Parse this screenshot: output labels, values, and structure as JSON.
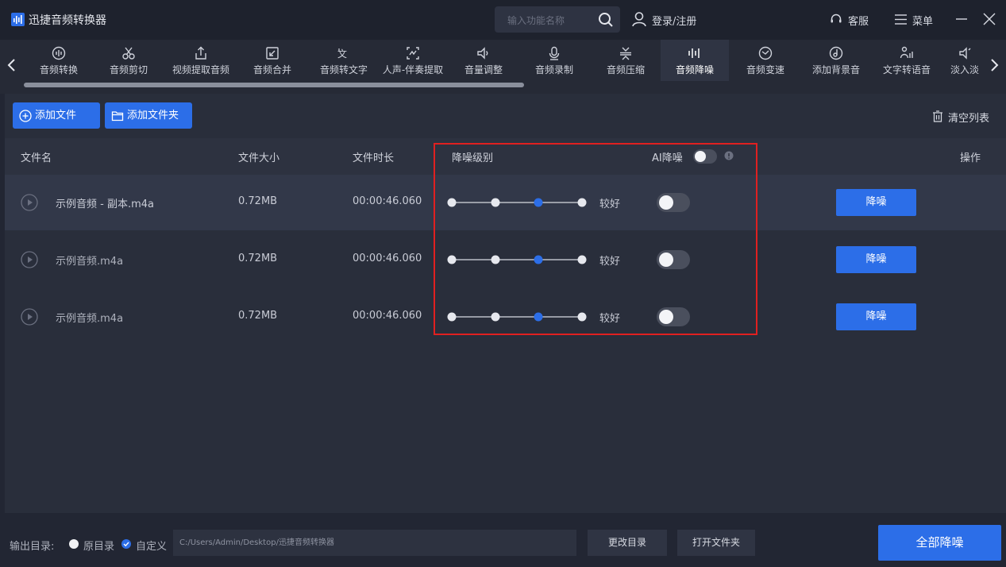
{
  "app": {
    "title": "迅捷音频转换器"
  },
  "header": {
    "search_placeholder": "输入功能名称",
    "login": "登录/注册",
    "service": "客服",
    "menu": "菜单"
  },
  "toolbar": {
    "tools": [
      {
        "label": "音频转换",
        "icon": "audio-convert-icon"
      },
      {
        "label": "音频剪切",
        "icon": "scissors-icon"
      },
      {
        "label": "视频提取音频",
        "icon": "upload-icon"
      },
      {
        "label": "音频合并",
        "icon": "merge-icon"
      },
      {
        "label": "音频转文字",
        "icon": "text-icon"
      },
      {
        "label": "人声-伴奏提取",
        "icon": "vocal-icon"
      },
      {
        "label": "音量调整",
        "icon": "volume-icon"
      },
      {
        "label": "音频录制",
        "icon": "mic-icon"
      },
      {
        "label": "音频压缩",
        "icon": "compress-icon"
      },
      {
        "label": "音频降噪",
        "icon": "denoise-icon",
        "active": true
      },
      {
        "label": "音频变速",
        "icon": "speed-icon"
      },
      {
        "label": "添加背景音",
        "icon": "music-note-icon"
      },
      {
        "label": "文字转语音",
        "icon": "tts-icon"
      },
      {
        "label": "淡入淡",
        "icon": "fade-icon"
      }
    ]
  },
  "actions": {
    "add_file": "添加文件",
    "add_folder": "添加文件夹",
    "clear_list": "清空列表"
  },
  "table": {
    "headers": {
      "name": "文件名",
      "size": "文件大小",
      "duration": "文件时长",
      "level": "降噪级别",
      "ai": "AI降噪",
      "action": "操作"
    },
    "rows": [
      {
        "name": "示例音频 - 副本.m4a",
        "size": "0.72MB",
        "duration": "00:00:46.060",
        "level_label": "较好",
        "level_index": 3,
        "ai_enabled": false,
        "button": "降噪",
        "selected": true
      },
      {
        "name": "示例音频.m4a",
        "size": "0.72MB",
        "duration": "00:00:46.060",
        "level_label": "较好",
        "level_index": 3,
        "ai_enabled": false,
        "button": "降噪",
        "selected": false
      },
      {
        "name": "示例音频.m4a",
        "size": "0.72MB",
        "duration": "00:00:46.060",
        "level_label": "较好",
        "level_index": 3,
        "ai_enabled": false,
        "button": "降噪",
        "selected": false
      }
    ]
  },
  "footer": {
    "output_label": "输出目录:",
    "option_original": "原目录",
    "option_custom": "自定义",
    "selected_option": "custom",
    "path": "C:/Users/Admin/Desktop/迅捷音频转换器",
    "change_dir": "更改目录",
    "open_folder": "打开文件夹",
    "run_all": "全部降噪"
  },
  "colors": {
    "accent": "#2c6ee8",
    "highlight": "#e02020",
    "background": "#222633"
  }
}
